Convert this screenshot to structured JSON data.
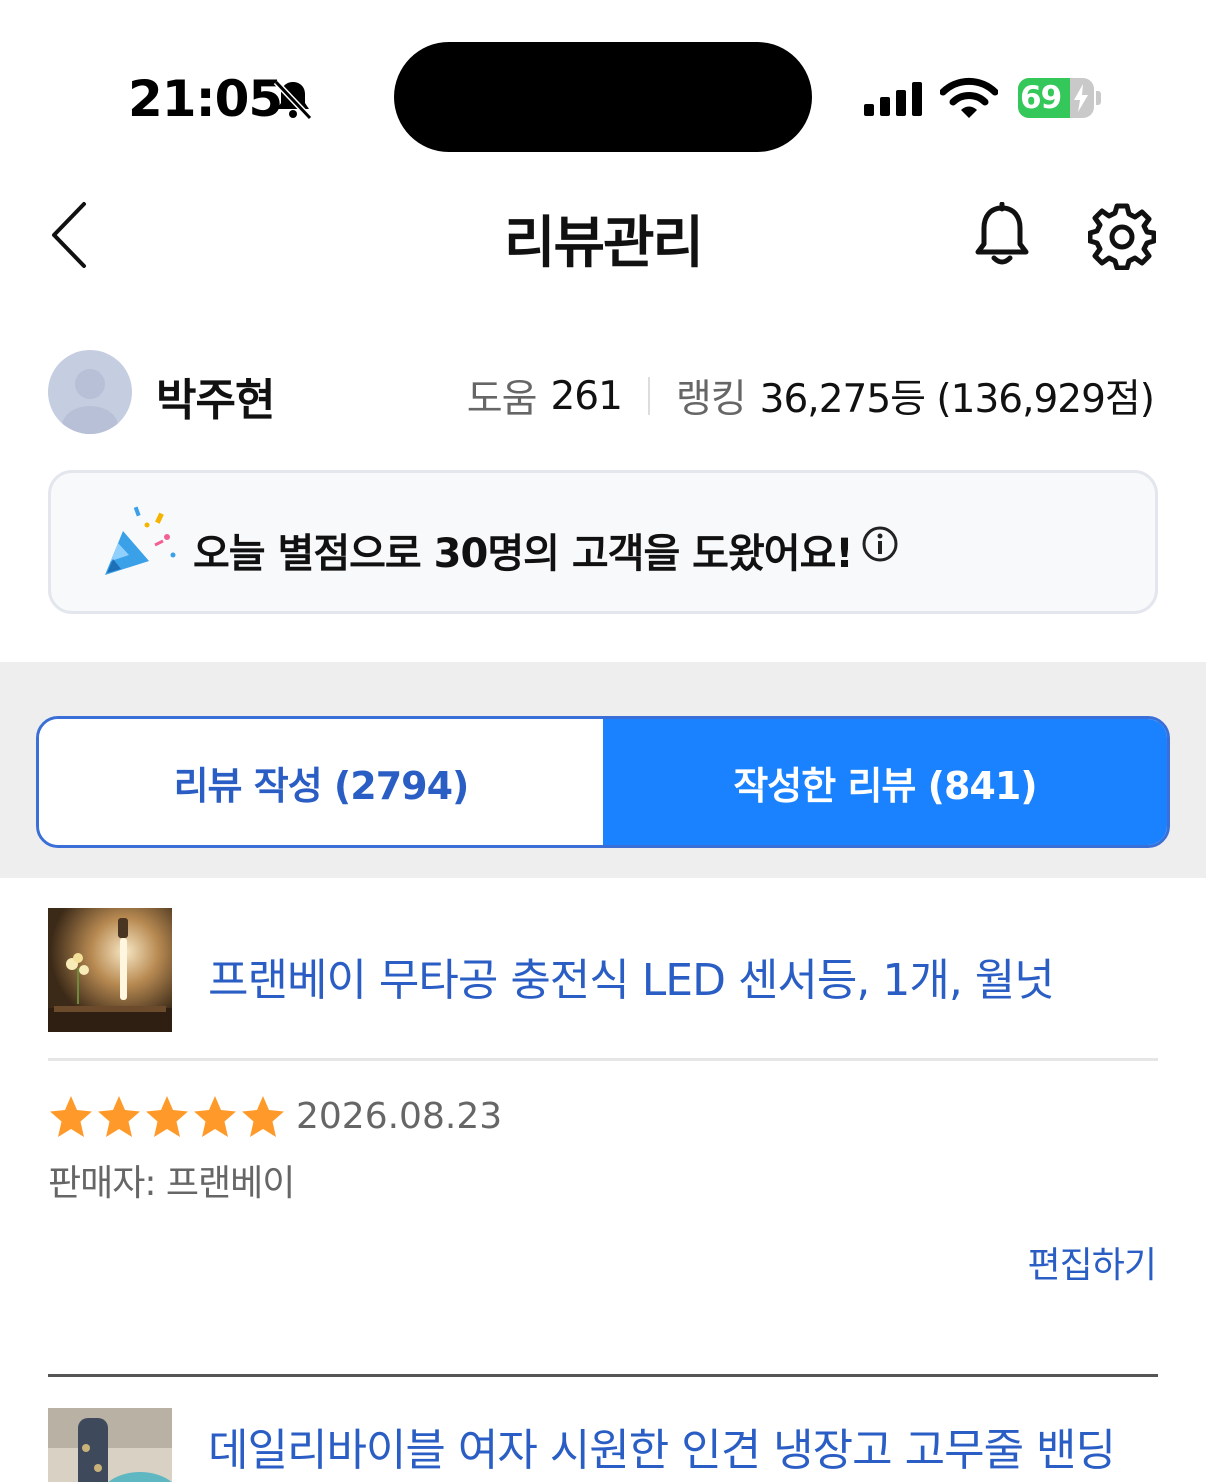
{
  "status_bar": {
    "time": "21:05",
    "battery": "69",
    "battery_level": 0.69,
    "icons": [
      "bell-slash-icon",
      "cellular-signal-icon",
      "wifi-icon",
      "battery-charging-icon"
    ]
  },
  "header": {
    "title": "리뷰관리",
    "icons": [
      "chevron-left-icon",
      "bell-icon",
      "gear-icon"
    ]
  },
  "profile": {
    "name": "박주현",
    "help_label": "도움",
    "help_value": "261",
    "ranking_label": "랭킹",
    "ranking_value": "36,275등 (136,929점)"
  },
  "banner": {
    "text": "오늘 별점으로 30명의 고객을 도왔어요!",
    "icons": [
      "party-popper-icon",
      "info-icon"
    ]
  },
  "tabs": [
    {
      "label": "리뷰 작성 (2794)",
      "active": false
    },
    {
      "label": "작성한 리뷰 (841)",
      "active": true
    }
  ],
  "colors": {
    "accent": "#1a82ff",
    "link": "#2a5ec4",
    "star": "#ff9a2a",
    "battery_green": "#34c759"
  },
  "reviews": [
    {
      "product": "프랜베이 무타공 충전식 LED 센서등, 1개, 월넛",
      "rating": 5,
      "date": "2026.08.23",
      "seller": "판매자: 프랜베이",
      "edit_label": "편집하기"
    },
    {
      "product": "데일리바이블 여자 시원한 인견 냉장고 고무줄 밴딩"
    }
  ]
}
